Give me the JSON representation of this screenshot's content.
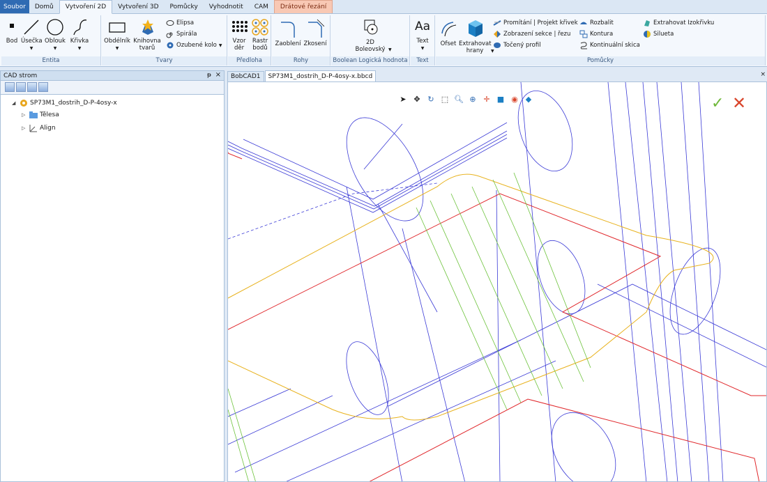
{
  "tabs": [
    "Soubor",
    "Domů",
    "Vytvoření 2D",
    "Vytvoření 3D",
    "Pomůcky",
    "Vyhodnotit",
    "CAM",
    "Drátové řezání"
  ],
  "groups": {
    "entita": {
      "label": "Entita",
      "buttons": [
        "Bod",
        "Úsečka",
        "Oblouk",
        "Křivka"
      ]
    },
    "tvary": {
      "label": "Tvary",
      "obdelnik": "Obdélník",
      "knihovna": "Knihovna tvarů",
      "elipsa": "Elipsa",
      "spirala": "Spirála",
      "kolo": "Ozubené kolo"
    },
    "predloha": {
      "label": "Předloha",
      "vzor": "Vzor děr",
      "rastr": "Rastr bodů"
    },
    "rohy": {
      "label": "Rohy",
      "zaobleni": "Zaoblení",
      "zkoseni": "Zkosení"
    },
    "boolean": {
      "label": "Boolean Logická hodnota",
      "btn": "2D Boleovský"
    },
    "text": {
      "label": "Text",
      "btn": "Text",
      "big": "Aa"
    },
    "pomucky": {
      "label": "Pomůcky",
      "ofset": "Ofset",
      "extrahovat": "Extrahovat hrany",
      "promitani": "Promítání | Projekt křivek",
      "zobrazeni": "Zobrazení sekce | řezu",
      "toceny": "Točený profil",
      "rozbalit": "Rozbalit",
      "kontura": "Kontura",
      "kontinualni": "Kontinuální skica",
      "izokrivku": "Extrahovat Izokřivku",
      "silueta": "Silueta"
    }
  },
  "panel": {
    "title": "CAD strom",
    "pin": "ᵽ",
    "close": "×",
    "root": "SP73M1_dostrih_D-P-4osy-x",
    "children": [
      "Tělesa",
      "Align"
    ]
  },
  "doc_tabs": [
    "BobCAD1",
    "SP73M1_dostrih_D-P-4osy-x.bbcd"
  ],
  "doc_close": "×",
  "colors": {
    "accent": "#2f6bb3",
    "blue_line": "#3a3ad6",
    "red_line": "#e0262a",
    "yellow_line": "#e8b21e",
    "green_line": "#6cc23a"
  }
}
